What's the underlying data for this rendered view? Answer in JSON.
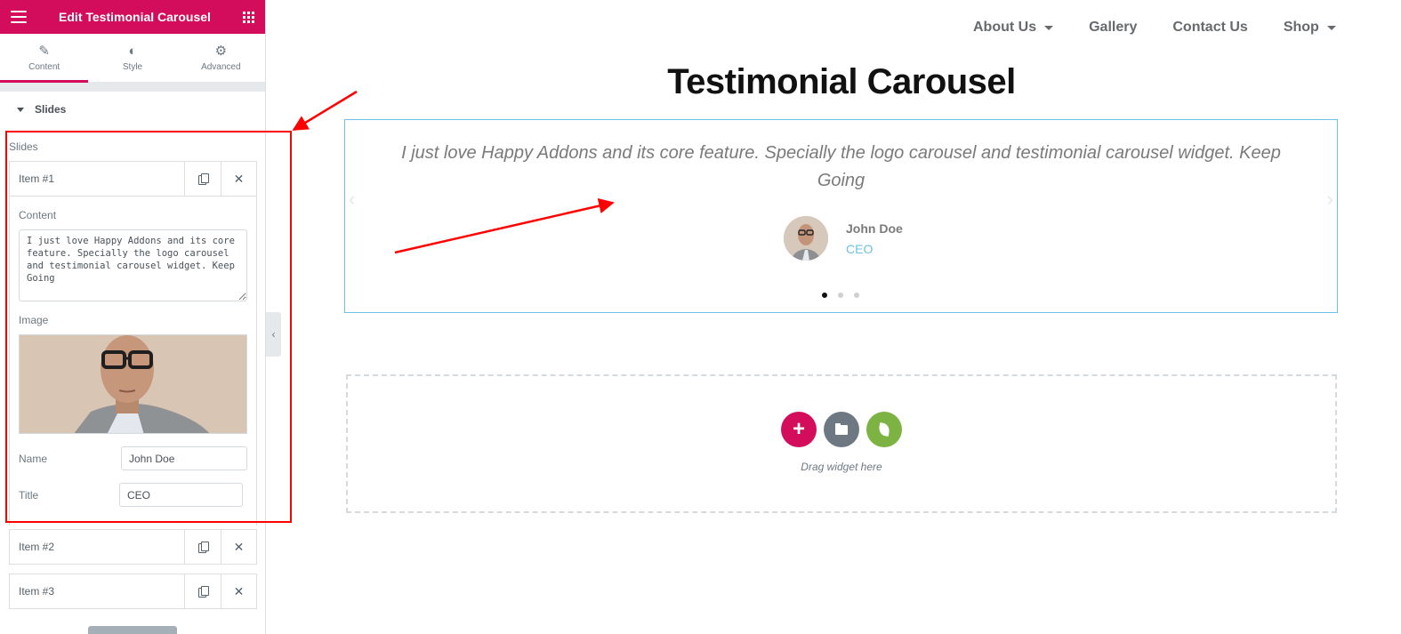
{
  "panel": {
    "title": "Edit Testimonial Carousel",
    "tabs": [
      {
        "label": "Content",
        "icon": "pencil-icon"
      },
      {
        "label": "Style",
        "icon": "half-circle-icon"
      },
      {
        "label": "Advanced",
        "icon": "gear-icon"
      }
    ],
    "section_title": "Slides",
    "slides_label": "Slides",
    "items": [
      {
        "label": "Item #1"
      },
      {
        "label": "Item #2"
      },
      {
        "label": "Item #3"
      }
    ],
    "item1": {
      "content_label": "Content",
      "content_value": "I just love Happy Addons and its core feature. Specially the logo carousel and testimonial carousel widget. Keep Going",
      "image_label": "Image",
      "name_label": "Name",
      "name_value": "John Doe",
      "title_label": "Title",
      "title_value": "CEO"
    }
  },
  "nav": {
    "items": [
      {
        "label": "About Us",
        "dropdown": true
      },
      {
        "label": "Gallery",
        "dropdown": false
      },
      {
        "label": "Contact Us",
        "dropdown": false
      },
      {
        "label": "Shop",
        "dropdown": true
      }
    ]
  },
  "page": {
    "title": "Testimonial Carousel"
  },
  "carousel": {
    "quote": "I just love Happy Addons and its core feature. Specially the logo carousel and testimonial carousel widget. Keep Going",
    "author_name": "John Doe",
    "author_title": "CEO",
    "slide_count": 3,
    "active_slide": 1
  },
  "drop_area": {
    "text": "Drag widget here"
  },
  "colors": {
    "brand": "#d30c5c",
    "accent": "#6ec1e4",
    "annotation": "#ff0000",
    "happy_green": "#7cb342"
  }
}
